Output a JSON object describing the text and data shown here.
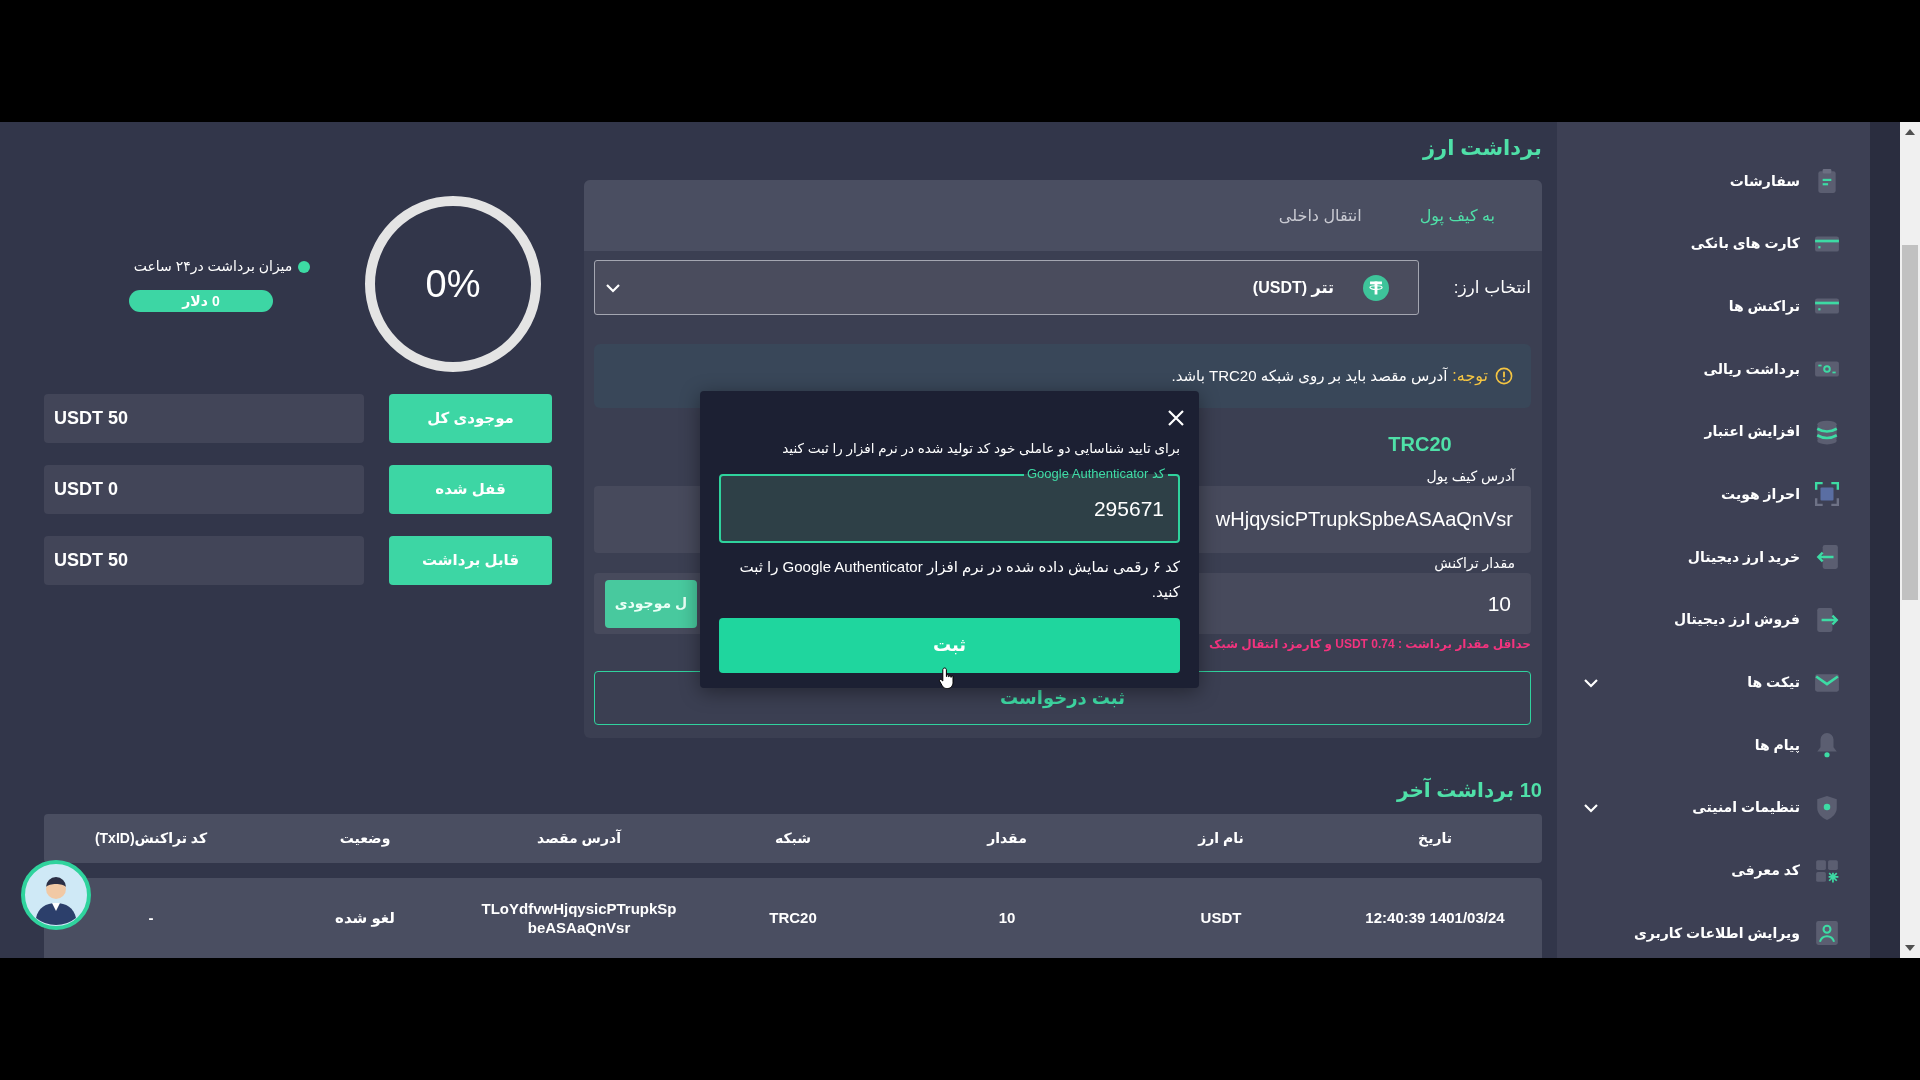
{
  "page_title": "برداشت ارز",
  "withdraw_form": {
    "tabs": [
      {
        "label": "به کیف پول",
        "selected": true
      },
      {
        "label": "انتقال داخلی",
        "selected": false
      }
    ],
    "currency_select": {
      "label": "انتخاب ارز:",
      "value": "تتر (USDT)"
    },
    "notice": {
      "label": "توجه:",
      "text": "آدرس مقصد باید بر روی شبکه TRC20 باشد."
    },
    "networks": [
      {
        "label": "TRC20",
        "selected": true
      }
    ],
    "address_field": {
      "label": "آدرس کیف پول",
      "value": "wHjqysicPTrupkSpbeASAaQnVsr"
    },
    "amount_field": {
      "label": "مقدار تراکنش",
      "value": "10",
      "max_button": "ل موجودی"
    },
    "minimum_note": "حداقل مقدار برداشت : USDT 0.74 و کارمزد انتقال شبک",
    "submit_button": "ثبت درخواست"
  },
  "withdrawal_gauge": {
    "level": 0,
    "reading": "0%"
  },
  "daily_limit": {
    "label": "میزان برداشت در۲۴ ساعت",
    "value": "0 دلار"
  },
  "balances": [
    {
      "label": "موجودی کل",
      "value": "USDT 50"
    },
    {
      "label": "قفل شده",
      "value": "USDT 0"
    },
    {
      "label": "قابل برداشت",
      "value": "USDT 50"
    }
  ],
  "recent_withdrawals": {
    "title": "10 برداشت آخر",
    "columns": [
      "تاریخ",
      "نام ارز",
      "مقدار",
      "شبکه",
      "آدرس مقصد",
      "وضعیت",
      "کد تراکنش(TxID)"
    ],
    "rows": [
      [
        "1401/03/24 12:40:39",
        "USDT",
        "10",
        "TRC20",
        "TLoYdfvwHjqysicPTrupkSpbeASAaQnVsr",
        "لغو شده",
        "-"
      ]
    ]
  },
  "two_factor_dialog": {
    "message": "برای تایید شناسایی دو عاملی خود کد تولید شده در نرم افزار را ثبت کنید",
    "field": {
      "label": "کد Google Authenticator",
      "value": "295671"
    },
    "help": "کد ۶ رقمی نمایش داده شده در نرم افزار Google Authenticator را ثبت کنید.",
    "button": "ثبت"
  },
  "sidebar": {
    "items": [
      {
        "label": "سفارشات",
        "kind": "link",
        "selected": false
      },
      {
        "label": "کارت های بانکی",
        "kind": "link",
        "selected": false
      },
      {
        "label": "تراکنش ها",
        "kind": "link",
        "selected": false
      },
      {
        "label": "برداشت ریالی",
        "kind": "link",
        "selected": false
      },
      {
        "label": "افزایش اعتبار",
        "kind": "link",
        "selected": false
      },
      {
        "label": "احراز هویت",
        "kind": "link",
        "selected": false
      },
      {
        "label": "خرید ارز دیجیتال",
        "kind": "link",
        "selected": false
      },
      {
        "label": "فروش ارز دیجیتال",
        "kind": "link",
        "selected": false
      },
      {
        "label": "تیکت ها",
        "kind": "group",
        "selected": false
      },
      {
        "label": "پیام ها",
        "kind": "link",
        "selected": false
      },
      {
        "label": "تنظیمات امنیتی",
        "kind": "group",
        "selected": false
      },
      {
        "label": "کد معرفی",
        "kind": "link",
        "selected": false
      },
      {
        "label": "ویرایش اطلاعات کاربری",
        "kind": "link",
        "selected": false
      }
    ]
  }
}
